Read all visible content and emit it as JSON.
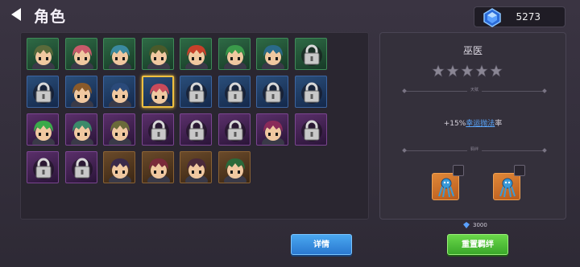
{
  "header": {
    "title": "角色",
    "currency": {
      "value": "5273",
      "icon": "blue-gem-icon"
    }
  },
  "roster": {
    "rows": [
      [
        {
          "frame": "green",
          "state": "portrait",
          "hair": "#5a6a3a"
        },
        {
          "frame": "green",
          "state": "portrait",
          "hair": "#c85a6a"
        },
        {
          "frame": "green",
          "state": "portrait",
          "hair": "#3a8aa0"
        },
        {
          "frame": "green",
          "state": "portrait",
          "hair": "#4a5a2a"
        },
        {
          "frame": "green",
          "state": "portrait",
          "hair": "#c8402a"
        },
        {
          "frame": "green",
          "state": "portrait",
          "hair": "#3a9a4a"
        },
        {
          "frame": "green",
          "state": "portrait",
          "hair": "#2a6a8a"
        },
        {
          "frame": "green",
          "state": "locked"
        }
      ],
      [
        {
          "frame": "blue",
          "state": "locked"
        },
        {
          "frame": "blue",
          "state": "portrait",
          "hair": "#8a5a2a"
        },
        {
          "frame": "blue",
          "state": "portrait",
          "hair": "#2a4a7a"
        },
        {
          "frame": "blue",
          "state": "portrait",
          "hair": "#c84a5a",
          "selected": true
        },
        {
          "frame": "blue",
          "state": "locked"
        },
        {
          "frame": "blue",
          "state": "locked"
        },
        {
          "frame": "blue",
          "state": "locked"
        },
        {
          "frame": "blue",
          "state": "locked"
        }
      ],
      [
        {
          "frame": "purple",
          "state": "portrait",
          "hair": "#3aaa4a"
        },
        {
          "frame": "purple",
          "state": "portrait",
          "hair": "#3a8a6a"
        },
        {
          "frame": "purple",
          "state": "portrait",
          "hair": "#6a6a3a"
        },
        {
          "frame": "purple",
          "state": "locked"
        },
        {
          "frame": "purple",
          "state": "locked"
        },
        {
          "frame": "purple",
          "state": "locked"
        },
        {
          "frame": "purple",
          "state": "portrait",
          "hair": "#8a2a5a"
        },
        {
          "frame": "purple",
          "state": "locked"
        }
      ],
      [
        {
          "frame": "purple",
          "state": "locked"
        },
        {
          "frame": "purple",
          "state": "locked"
        },
        {
          "frame": "orange",
          "state": "portrait",
          "hair": "#3a2a4a"
        },
        {
          "frame": "orange",
          "state": "portrait",
          "hair": "#7a2a3a"
        },
        {
          "frame": "orange",
          "state": "portrait",
          "hair": "#4a2a3a"
        },
        {
          "frame": "orange",
          "state": "portrait",
          "hair": "#2a6a3a"
        }
      ]
    ]
  },
  "detail": {
    "name": "巫医",
    "stars": 5,
    "stars_filled": 0,
    "talent_divider": "天赋",
    "talent_prefix": "+15%",
    "talent_link": "幸运抛法",
    "talent_suffix": "率",
    "bond_divider": "羁绊",
    "bonds": [
      {
        "icon": "squid-rune-icon",
        "color": "#e08838"
      },
      {
        "icon": "squid-rune-icon",
        "color": "#e08838"
      }
    ]
  },
  "actions": {
    "detail_label": "详情",
    "reset_label": "重置羁绊",
    "reset_cost": "3000",
    "reset_cost_icon": "blue-gem-icon"
  }
}
